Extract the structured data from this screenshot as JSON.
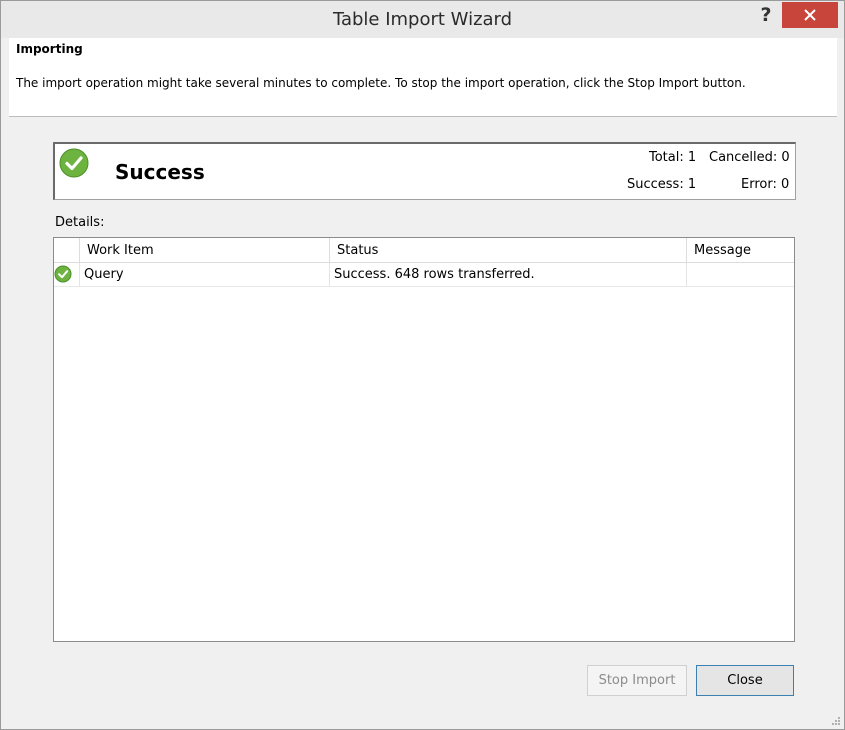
{
  "window": {
    "title": "Table Import Wizard",
    "help_label": "?"
  },
  "header": {
    "title": "Importing",
    "description": "The import operation might take several minutes to complete. To stop the import operation, click the Stop Import button."
  },
  "summary": {
    "status": "Success",
    "status_icon": "success-check-icon",
    "total_label": "Total: 1",
    "cancelled_label": "Cancelled: 0",
    "success_label": "Success: 1",
    "error_label": "Error: 0"
  },
  "details": {
    "label": "Details:",
    "columns": [
      "Work Item",
      "Status",
      "Message"
    ],
    "rows": [
      {
        "icon": "success-check-icon",
        "work_item": "Query",
        "status": "Success. 648 rows transferred.",
        "message": ""
      }
    ]
  },
  "buttons": {
    "stop_import": "Stop Import",
    "close": "Close"
  },
  "colors": {
    "success_green": "#6db33f",
    "close_red": "#c7453a",
    "focus_blue": "#3c7fb1"
  }
}
